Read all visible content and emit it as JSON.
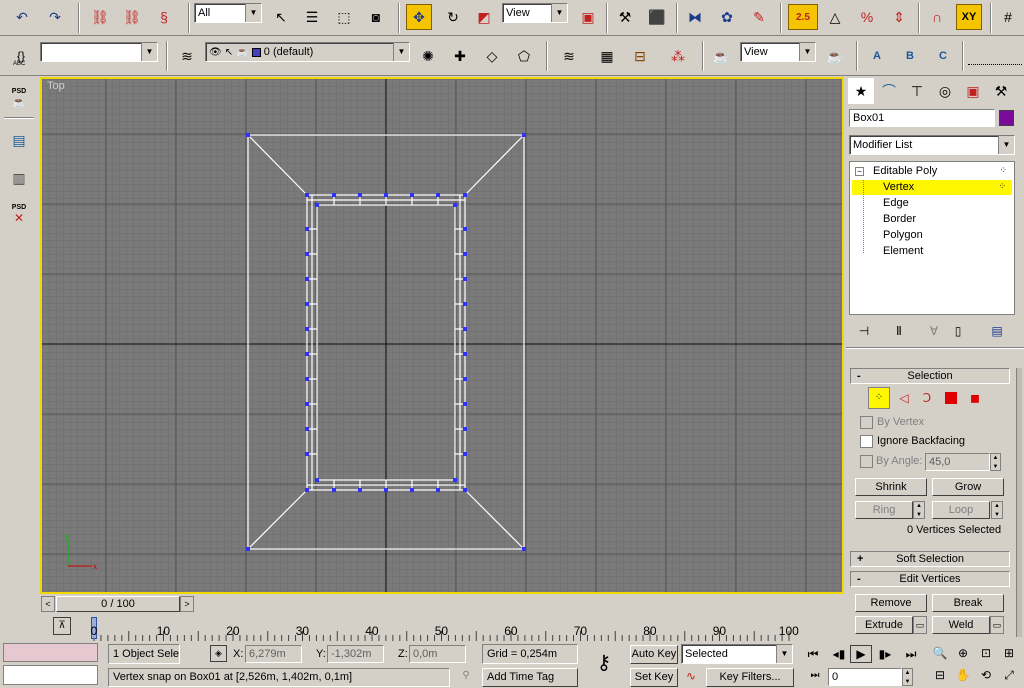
{
  "main_toolbar": {
    "selection_filter": "All",
    "ref_coord": "View",
    "snap_label": "2.5",
    "axis_label": "XY"
  },
  "layer_toolbar": {
    "named_sel": "",
    "layer": "0 (default)",
    "view": "View",
    "brace_icon_label": "ABC"
  },
  "render_icons": {
    "a": "A",
    "b": "B",
    "c": "C"
  },
  "viewport": {
    "label": "Top"
  },
  "left_toolbar": {
    "psd_label": "PSD"
  },
  "command_panel": {
    "object_name": "Box01",
    "object_color": "#7a0a9a",
    "modifier_list": "Modifier List",
    "stack": [
      {
        "label": "Editable Poly",
        "selected": false,
        "sub": false
      },
      {
        "label": "Vertex",
        "selected": true,
        "sub": true
      },
      {
        "label": "Edge",
        "selected": false,
        "sub": true
      },
      {
        "label": "Border",
        "selected": false,
        "sub": true
      },
      {
        "label": "Polygon",
        "selected": false,
        "sub": true
      },
      {
        "label": "Element",
        "selected": false,
        "sub": true
      }
    ],
    "selection_title": "Selection",
    "by_vertex": "By Vertex",
    "ignore_backfacing": "Ignore Backfacing",
    "by_angle": "By Angle:",
    "angle_value": "45,0",
    "shrink": "Shrink",
    "grow": "Grow",
    "ring": "Ring",
    "loop": "Loop",
    "selected_count": "0 Vertices Selected",
    "soft_selection": "Soft Selection",
    "edit_vertices": "Edit Vertices",
    "remove": "Remove",
    "break": "Break",
    "extrude": "Extrude",
    "weld": "Weld",
    "minus": "-",
    "plus": "+"
  },
  "timeline": {
    "frame_label": "0 / 100",
    "ticks": [
      "0",
      "10",
      "20",
      "30",
      "40",
      "50",
      "60",
      "70",
      "80",
      "90",
      "100"
    ]
  },
  "status": {
    "object_count": "1 Object Sele",
    "x_label": "X:",
    "x_value": "6,279m",
    "y_label": "Y:",
    "y_value": "-1,302m",
    "z_label": "Z:",
    "z_value": "0,0m",
    "grid": "Grid = 0,254m",
    "prompt": "Vertex snap on Box01 at [2,526m, 1,402m, 0,1m]",
    "add_time_tag": "Add Time Tag",
    "auto_key": "Auto Key",
    "set_key": "Set Key",
    "key_mode": "Selected",
    "key_filters": "Key Filters...",
    "current_frame": "0"
  }
}
